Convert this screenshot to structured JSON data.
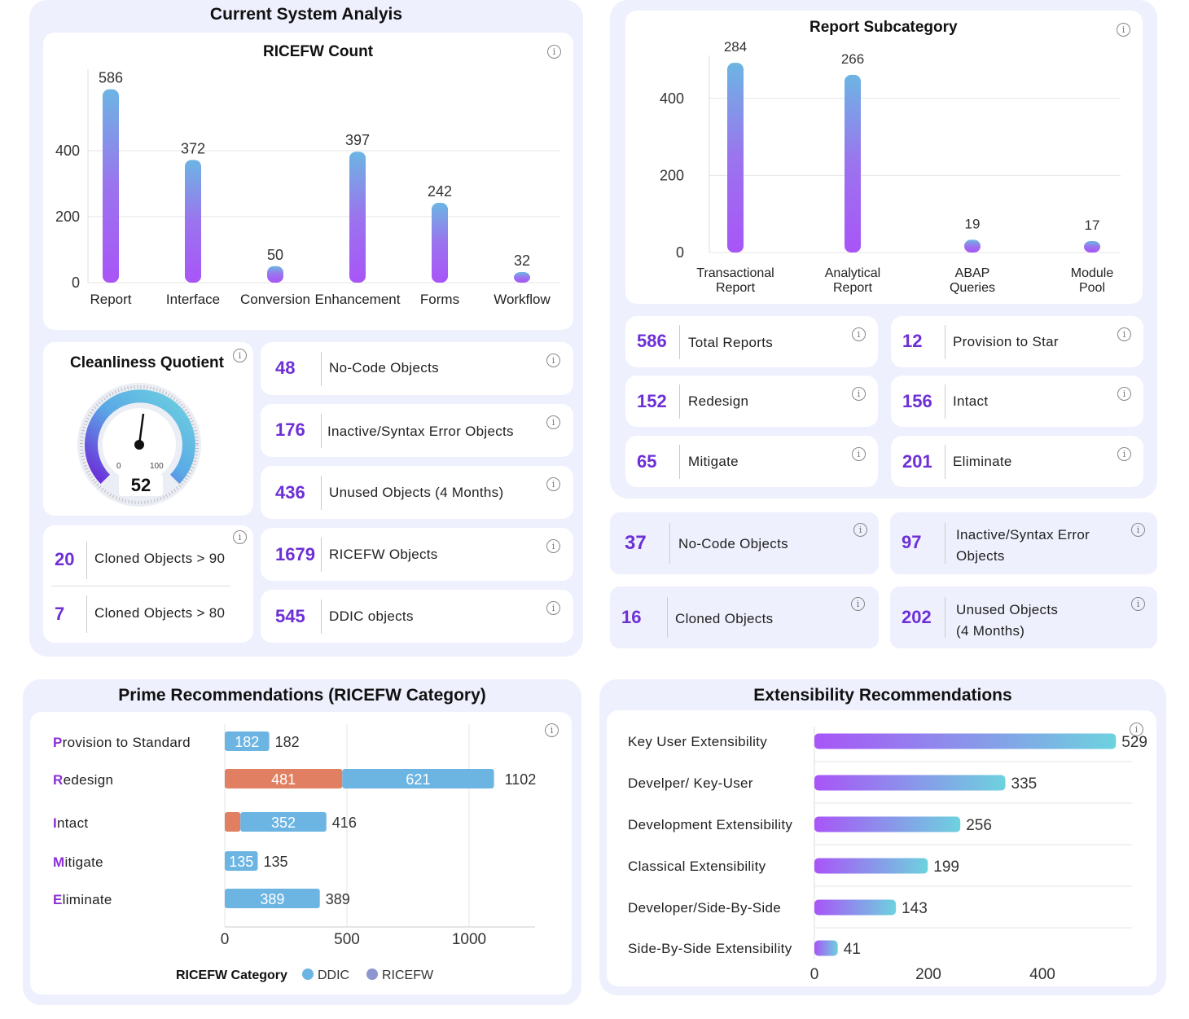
{
  "analysis": {
    "title": "Current System Analyis"
  },
  "ricefw": {
    "title": "RICEFW Count"
  },
  "cleanliness": {
    "title": "Cleanliness Quotient",
    "value": "52",
    "min_label": "0",
    "max_label": "100"
  },
  "analysis_cards": [
    {
      "value": "48",
      "label": "No-Code Objects"
    },
    {
      "value": "176",
      "label": "Inactive/Syntax Error Objects"
    },
    {
      "value": "436",
      "label": "Unused Objects (4 Months)"
    },
    {
      "value": "1679",
      "label": "RICEFW Objects"
    },
    {
      "value": "545",
      "label": "DDIC objects"
    }
  ],
  "cloned": [
    {
      "value": "20",
      "label": "Cloned Objects > 90"
    },
    {
      "value": "7",
      "label": "Cloned Objects > 80"
    }
  ],
  "report_sub": {
    "title": "Report Subcategory"
  },
  "report_cards": [
    {
      "value": "586",
      "label": "Total Reports"
    },
    {
      "value": "12",
      "label": "Provision to Star"
    },
    {
      "value": "152",
      "label": "Redesign"
    },
    {
      "value": "156",
      "label": "Intact"
    },
    {
      "value": "65",
      "label": "Mitigate"
    },
    {
      "value": "201",
      "label": "Eliminate"
    }
  ],
  "report_objects": [
    {
      "value": "37",
      "label1": "No-Code Objects",
      "label2": ""
    },
    {
      "value": "97",
      "label1": "Inactive/Syntax Error",
      "label2": "Objects"
    },
    {
      "value": "16",
      "label1": "Cloned Objects",
      "label2": ""
    },
    {
      "value": "202",
      "label1": "Unused Objects",
      "label2": "(4 Months)"
    }
  ],
  "prime": {
    "title": "Prime Recommendations (RICEFW Category)"
  },
  "extensibility": {
    "title": "Extensibility Recommendations"
  },
  "colors": {
    "purple": "#a855f7",
    "blue": "#6cb5e3",
    "teal": "#6dd2de",
    "orange": "#e07f61",
    "accent": "#6d2fd6",
    "panel": "#eef0fd"
  },
  "chart_data": [
    {
      "type": "bar",
      "title": "RICEFW Count",
      "categories": [
        "Report",
        "Interface",
        "Conversion",
        "Enhancement",
        "Forms",
        "Workflow"
      ],
      "values": [
        586,
        372,
        50,
        397,
        242,
        32
      ],
      "yticks": [
        "0",
        "200",
        "400"
      ],
      "ylim": [
        0,
        586
      ],
      "grid": true
    },
    {
      "type": "bar",
      "title": "Report Subcategory",
      "categories": [
        [
          "Transactional",
          "Report"
        ],
        [
          "Analytical",
          "Report"
        ],
        [
          "ABAP",
          "Queries"
        ],
        [
          "Module",
          "Pool"
        ]
      ],
      "values": [
        284,
        266,
        19,
        17
      ],
      "yticks": [
        "0",
        "200",
        "400"
      ],
      "grid": true
    },
    {
      "type": "bar",
      "orientation": "horizontal",
      "stacked": true,
      "title": "Prime Recommendations (RICEFW Category)",
      "categories": [
        "Provision to Standard",
        "Redesign",
        "Intact",
        "Mitigate",
        "Eliminate"
      ],
      "series": [
        {
          "name": "RICEFW",
          "values": [
            0,
            481,
            64,
            0,
            0
          ],
          "labels": [
            "",
            "481",
            "",
            "",
            ""
          ]
        },
        {
          "name": "DDIC",
          "values": [
            182,
            621,
            352,
            135,
            389
          ],
          "labels": [
            "182",
            "621",
            "352",
            "135",
            "389"
          ]
        }
      ],
      "totals": [
        "182",
        "1102",
        "416",
        "135",
        "389"
      ],
      "xticks": [
        "0",
        "500",
        "1000"
      ],
      "xlim": [
        0,
        1250
      ],
      "legend_title": "RICEFW Category",
      "legend_position": "bottom"
    },
    {
      "type": "bar",
      "orientation": "horizontal",
      "title": "Extensibility Recommendations",
      "categories": [
        "Key User Extensibility",
        "Develper/ Key-User",
        "Development Extensibility",
        "Classical Extensibility",
        "Developer/Side-By-Side",
        "Side-By-Side Extensibility"
      ],
      "values": [
        529,
        335,
        256,
        199,
        143,
        41
      ],
      "xticks": [
        "0",
        "200",
        "400"
      ],
      "xlim": [
        0,
        560
      ]
    }
  ]
}
